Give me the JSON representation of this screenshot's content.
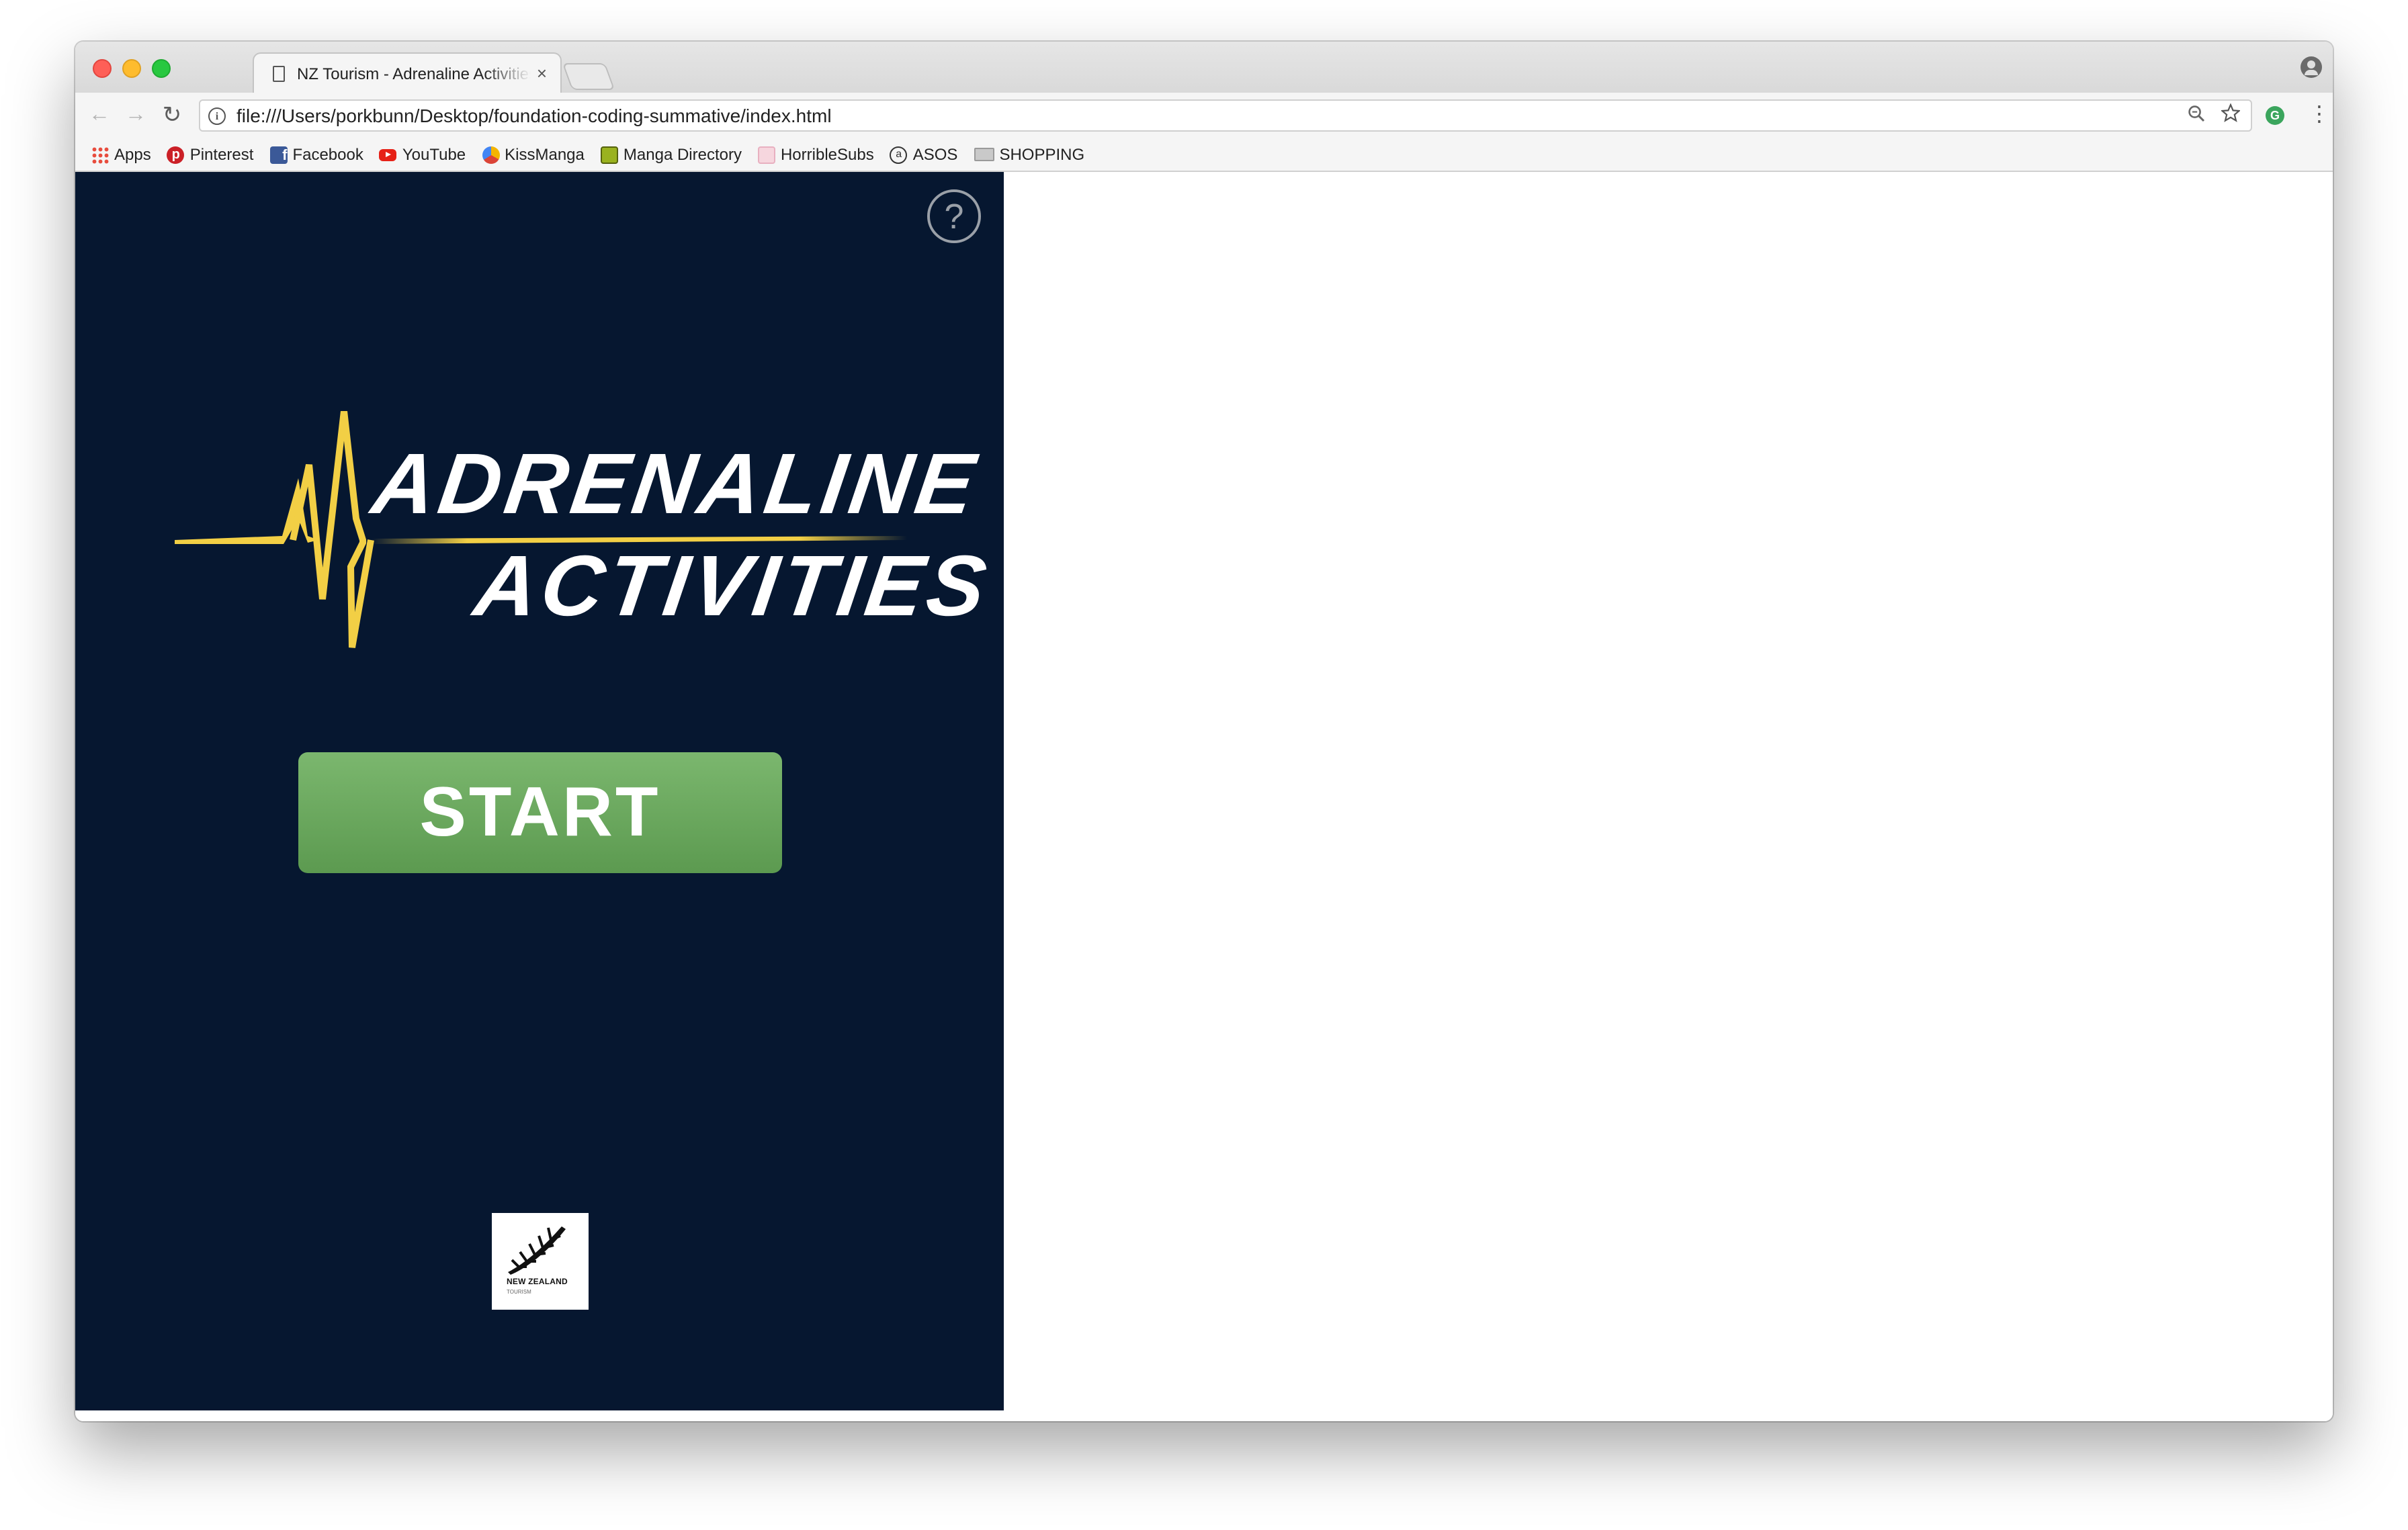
{
  "tab": {
    "title": "NZ Tourism - Adrenaline Activities",
    "close_glyph": "×"
  },
  "toolbar": {
    "back_glyph": "←",
    "forward_glyph": "→",
    "reload_glyph": "↻",
    "url": "file:///Users/porkbunn/Desktop/foundation-coding-summative/index.html",
    "menu_glyph": "⋮",
    "extension_letter": "G"
  },
  "bookmarks": [
    {
      "label": "Apps",
      "icon": "apps-grid-icon"
    },
    {
      "label": "Pinterest",
      "icon": "pinterest-icon"
    },
    {
      "label": "Facebook",
      "icon": "facebook-icon"
    },
    {
      "label": "YouTube",
      "icon": "youtube-icon"
    },
    {
      "label": "KissManga",
      "icon": "kissmanga-icon"
    },
    {
      "label": "Manga Directory",
      "icon": "manga-directory-icon"
    },
    {
      "label": "HorribleSubs",
      "icon": "horriblesubs-icon"
    },
    {
      "label": "ASOS",
      "icon": "asos-icon"
    },
    {
      "label": "SHOPPING",
      "icon": "folder-icon"
    }
  ],
  "app": {
    "help_label": "?",
    "logo_line1": "ADRENALINE",
    "logo_line2": "ACTIVITIES",
    "start_label": "START",
    "partner_logo_text": "NEW ZEALAND",
    "partner_logo_sub": "TOURISM"
  },
  "colors": {
    "panel_bg": "#061730",
    "accent_yellow": "#f2cf45",
    "start_green": "#6aa85d"
  }
}
